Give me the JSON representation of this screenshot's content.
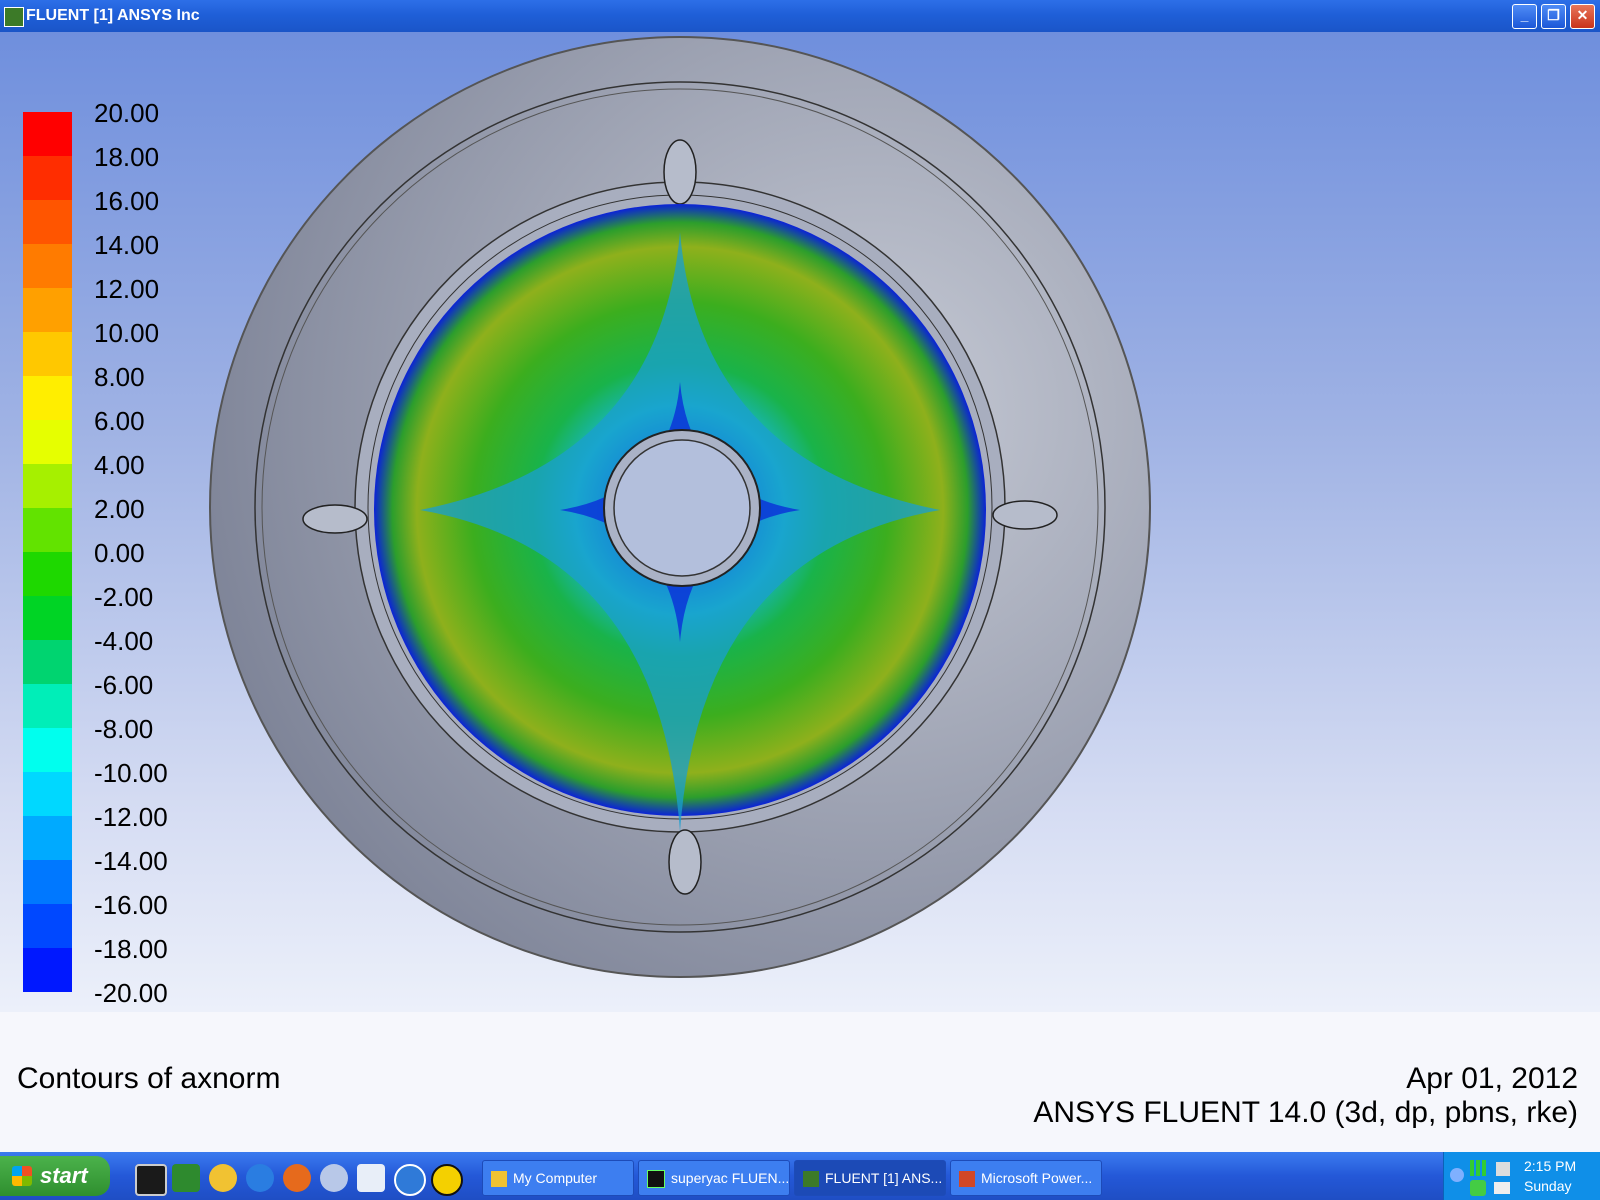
{
  "window": {
    "title": "FLUENT [1] ANSYS Inc",
    "minimize_glyph": "_",
    "maximize_glyph": "❐",
    "close_glyph": "✕"
  },
  "colorbar": {
    "labels": [
      "20.00",
      "18.00",
      "16.00",
      "14.00",
      "12.00",
      "10.00",
      "8.00",
      "6.00",
      "4.00",
      "2.00",
      "0.00",
      "-2.00",
      "-4.00",
      "-6.00",
      "-8.00",
      "-10.00",
      "-12.00",
      "-14.00",
      "-16.00",
      "-18.00",
      "-20.00"
    ],
    "colors": [
      "#ff0000",
      "#ff2d00",
      "#ff5500",
      "#ff7b00",
      "#ffa000",
      "#ffc800",
      "#ffee00",
      "#e6ff00",
      "#a6f000",
      "#62e300",
      "#1ed800",
      "#00d425",
      "#00d470",
      "#00eeb8",
      "#00ffee",
      "#00d8ff",
      "#00aaff",
      "#0078ff",
      "#0048ff",
      "#0018ff"
    ]
  },
  "info": {
    "caption": "Contours of axnorm",
    "date": "Apr 01, 2012",
    "version": "ANSYS FLUENT 14.0 (3d, dp, pbns, rke)"
  },
  "taskbar": {
    "start_label": "start",
    "tasks": [
      {
        "label": "My Computer",
        "active": false
      },
      {
        "label": "superyac FLUEN...",
        "active": false
      },
      {
        "label": "FLUENT [1] ANS...",
        "active": true
      },
      {
        "label": "Microsoft Power...",
        "active": false
      }
    ],
    "clock": "2:15 PM",
    "day": "Sunday"
  }
}
